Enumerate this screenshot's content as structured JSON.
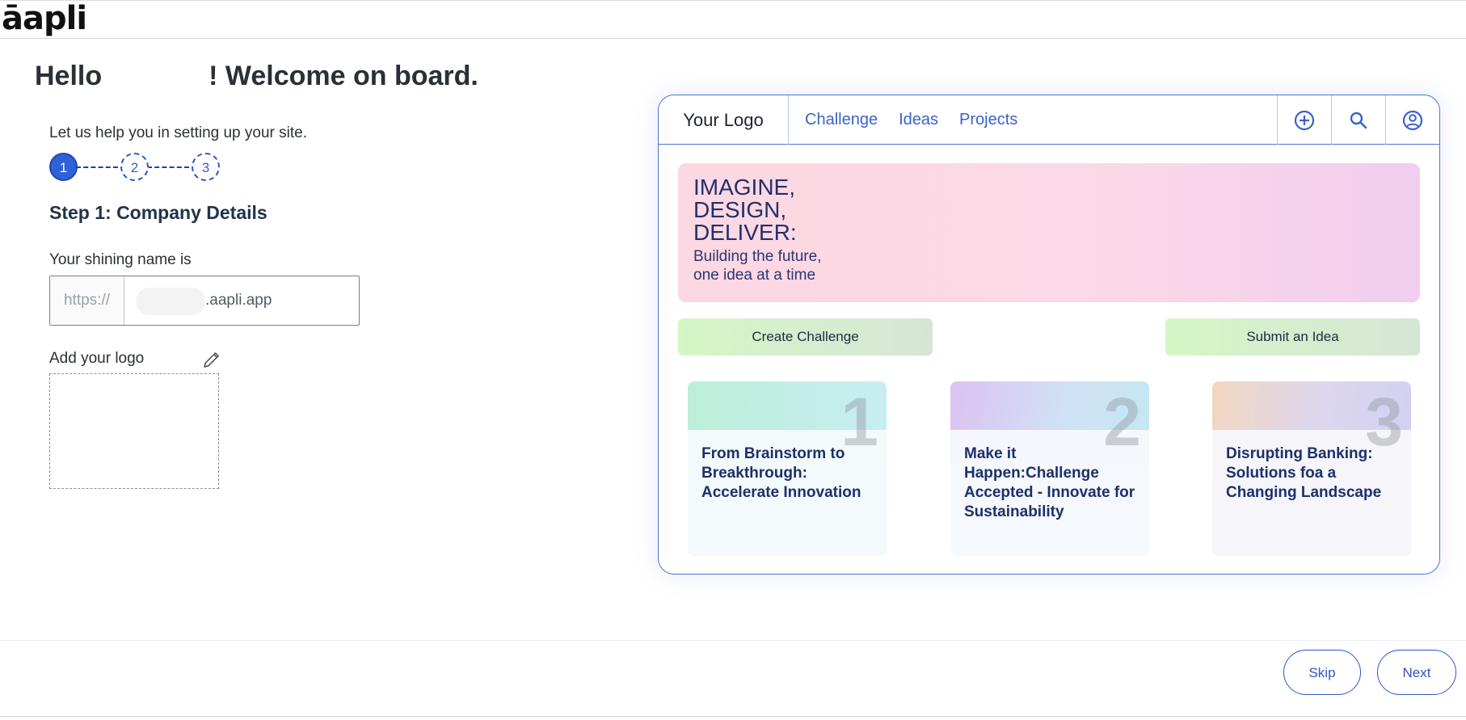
{
  "brand": {
    "name": "āapli"
  },
  "setup": {
    "greeting_prefix": "Hello",
    "greeting_suffix": "! Welcome on board.",
    "subtitle": "Let us help you in setting up your site.",
    "steps": [
      "1",
      "2",
      "3"
    ],
    "current_step": 1,
    "step_title": "Step 1: Company Details",
    "name_label": "Your shining name is",
    "url_prefix": "https://",
    "url_suffix": ".aapli.app",
    "logo_label": "Add your logo"
  },
  "preview": {
    "logo_text": "Your Logo",
    "nav_links": [
      "Challenge",
      "Ideas",
      "Projects"
    ],
    "icons": [
      "add-circle-icon",
      "search-icon",
      "user-account-icon"
    ],
    "hero_title": "IMAGINE,\nDESIGN,\nDELIVER:",
    "hero_subtitle": "Building the future,\none idea at a time",
    "cta_left": "Create Challenge",
    "cta_right": "Submit an Idea",
    "tiles": [
      {
        "number": "1",
        "text": "From Brainstorm to Breakthrough: Accelerate Innovation"
      },
      {
        "number": "2",
        "text": "Make it Happen:Challenge Accepted - Innovate for Sustainability"
      },
      {
        "number": "3",
        "text": "Disrupting Banking: Solutions foa a Changing Landscape"
      }
    ],
    "colors": {
      "accent": "#3b62c9",
      "border": "#4a78d8",
      "heading": "#1e2f6a"
    }
  },
  "footer": {
    "skip_label": "Skip",
    "next_label": "Next"
  },
  "colors": {
    "primary": "#2f62d8",
    "text": "#2b2f36"
  }
}
